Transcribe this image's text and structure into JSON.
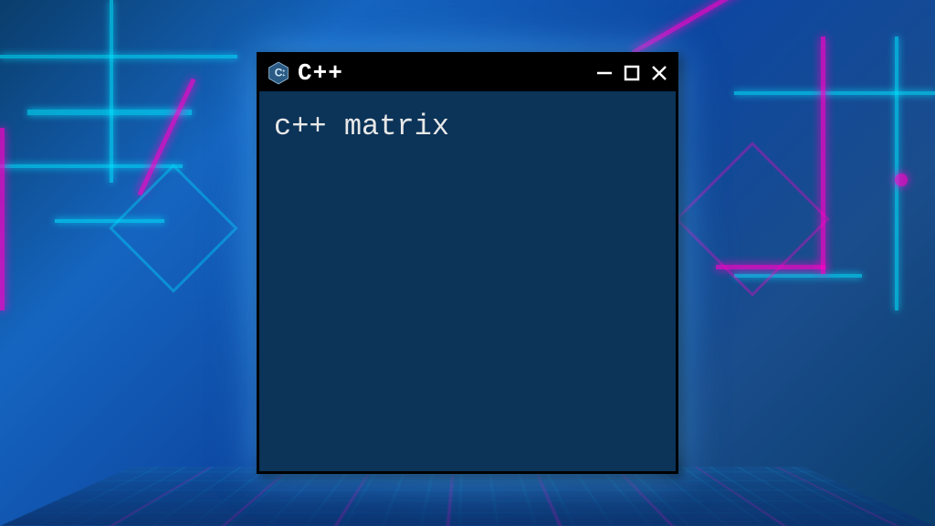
{
  "window": {
    "title": "C++",
    "icon": "cpp-logo-icon"
  },
  "controls": {
    "minimize": "minimize-icon",
    "maximize": "maximize-icon",
    "close": "close-icon"
  },
  "terminal": {
    "line1": "c++ matrix"
  },
  "colors": {
    "terminal_bg": "#0c3358",
    "terminal_fg": "#e8e8e8",
    "titlebar_bg": "#000000",
    "neon_cyan": "#00e5ff",
    "neon_pink": "#ff00c8"
  }
}
